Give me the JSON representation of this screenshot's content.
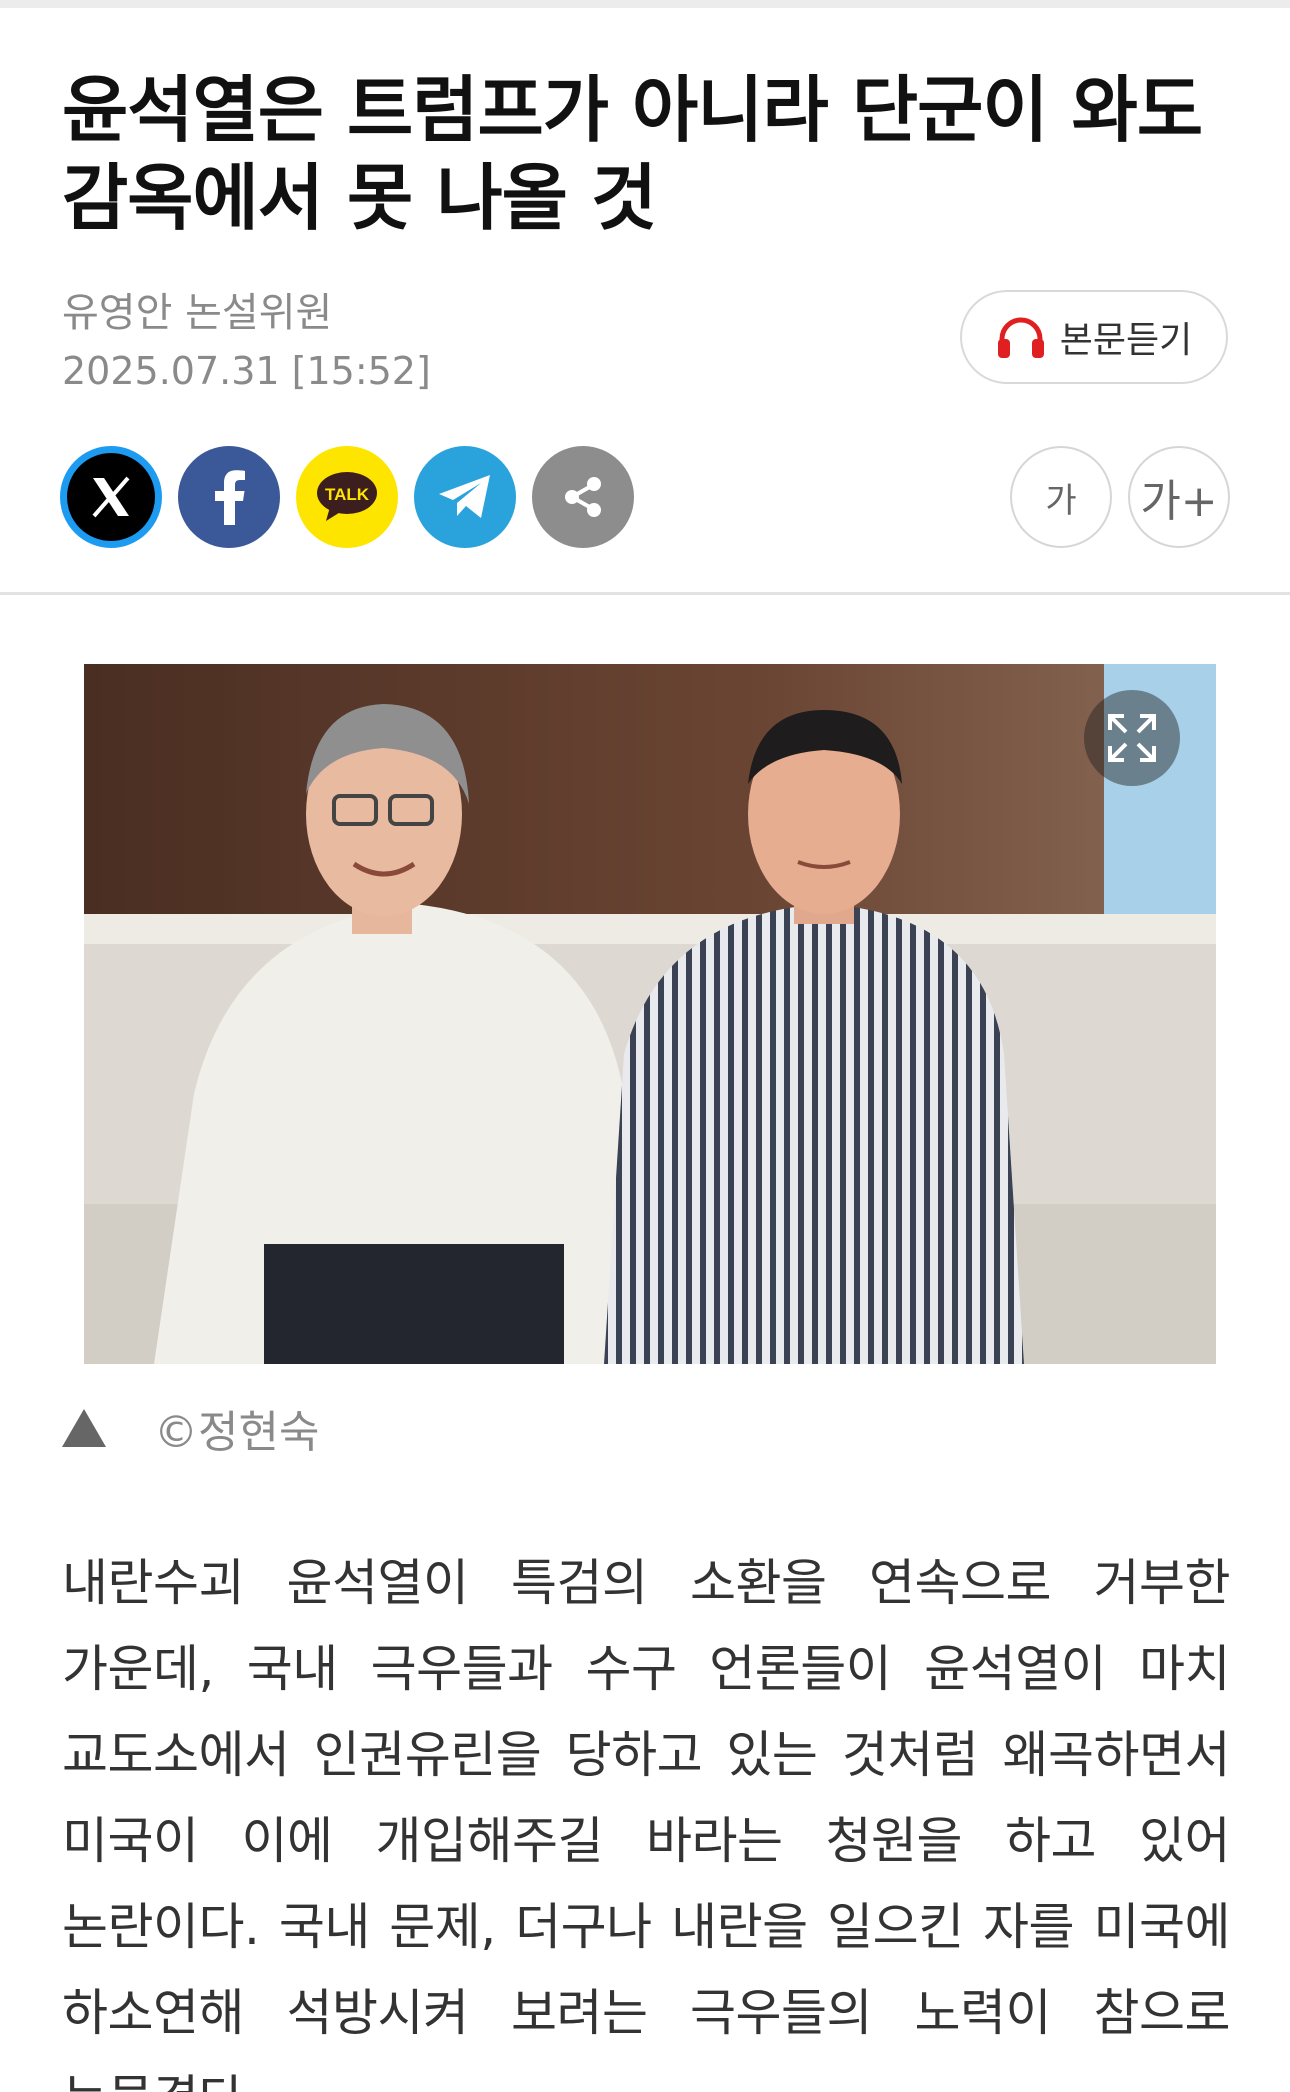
{
  "article": {
    "headline": "윤석열은 트럼프가 아니라 단군이 와도 감옥에서 못 나올 것",
    "author": "유영안 논설위원",
    "date": "2025.07.31 [15:52]",
    "listen_label": "본문듣기",
    "kakao_label": "TALK",
    "font_small_label": "가",
    "font_large_label": "가+",
    "photo_credit": "©정현숙",
    "body": "내란수괴 윤석열이 특검의 소환을 연속으로 거부한 가운데, 국내 극우들과 수구 언론들이 윤석열이 마치 교도소에서 인권유린을 당하고 있는 것처럼 왜곡하면서 미국이 이에 개입해주길 바라는 청원을 하고 있어 논란이다. 국내 문제, 더구나 내란을 일으킨 자를 미국에 하소연해 석방시켜 보려는 극우들의 노력이 참으로 눈물겹다."
  },
  "icons": {
    "listen": "headphones-icon",
    "share": [
      "x-icon",
      "facebook-icon",
      "kakaotalk-icon",
      "telegram-icon",
      "share-icon"
    ],
    "expand": "expand-icon",
    "caption_marker": "triangle-up-icon"
  },
  "colors": {
    "headline": "#111111",
    "meta": "#8a8a8a",
    "x_ring": "#1d9bf0",
    "facebook": "#3b5998",
    "kakao": "#fee500",
    "telegram": "#2aa3dd",
    "share_gray": "#8d8d8d",
    "listen_icon": "#e02020"
  }
}
